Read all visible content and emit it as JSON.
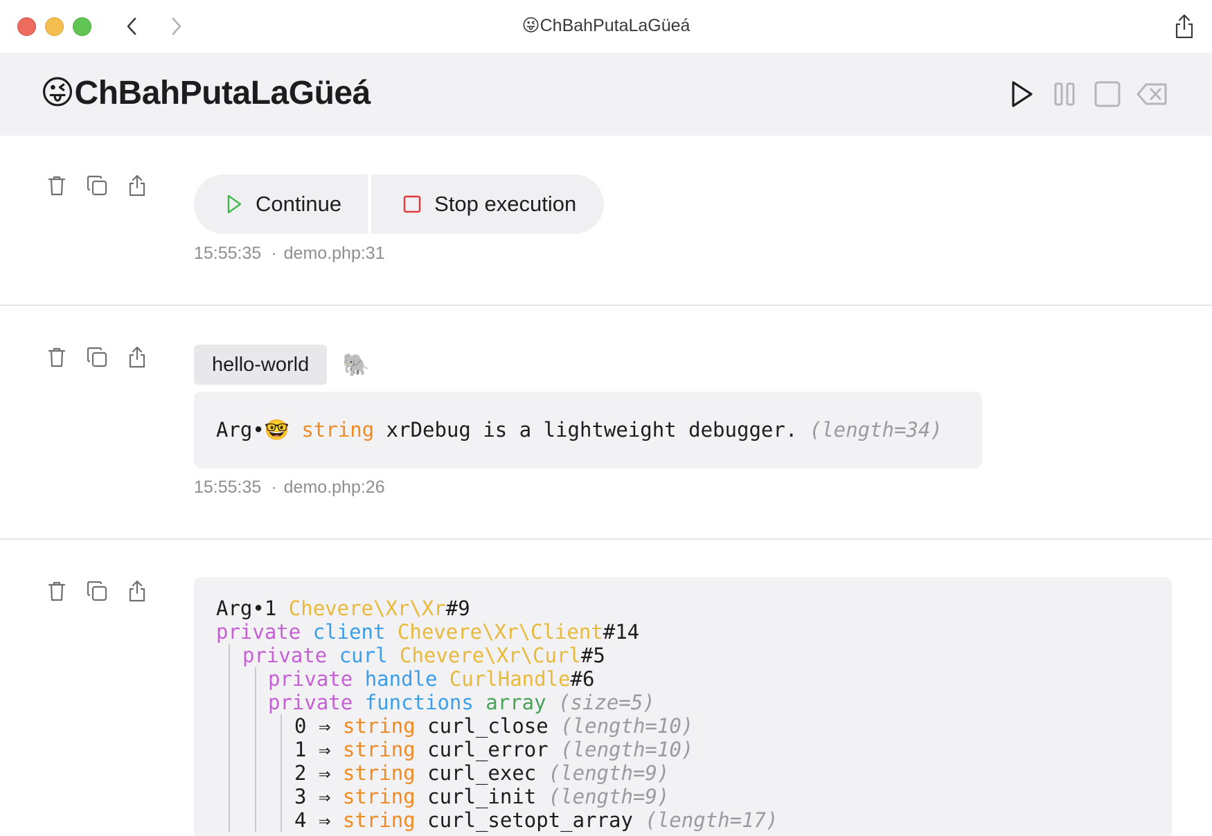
{
  "window": {
    "title": "😜ChBahPutaLaGüeá",
    "traffic_colors": {
      "close": "#ed6a5e",
      "minimize": "#f4bf4f",
      "zoom": "#61c554"
    },
    "icons": [
      "chevron-left-icon",
      "chevron-right-icon",
      "share-icon"
    ]
  },
  "header": {
    "title": "😜ChBahPutaLaGüeá",
    "controls": [
      "play-icon",
      "pause-icon",
      "stop-icon",
      "clear-icon"
    ]
  },
  "entries": [
    {
      "actions": [
        "trash-icon",
        "copy-icon",
        "share-icon"
      ],
      "buttons": {
        "continue": "Continue",
        "stop": "Stop execution"
      },
      "time": "15:55:35",
      "sep": "·",
      "file": "demo.php:31"
    },
    {
      "actions": [
        "trash-icon",
        "copy-icon",
        "share-icon"
      ],
      "tag": "hello-world",
      "emoji": "🐘",
      "code": {
        "arg": "Arg•",
        "arg_emoji": "🤓",
        "type": "string",
        "value": "xrDebug is a lightweight debugger.",
        "meta": "(length=34)"
      },
      "time": "15:55:35",
      "sep": "·",
      "file": "demo.php:26"
    },
    {
      "actions": [
        "trash-icon",
        "copy-icon",
        "share-icon"
      ],
      "dump": {
        "arg": "Arg•1",
        "root_class": "Chevere\\Xr\\Xr",
        "root_id": "#9",
        "private": "private",
        "client_prop": "client",
        "client_class": "Chevere\\Xr\\Client",
        "client_id": "#14",
        "curl_prop": "curl",
        "curl_class": "Chevere\\Xr\\Curl",
        "curl_id": "#5",
        "handle_prop": "handle",
        "handle_class": "CurlHandle",
        "handle_id": "#6",
        "functions_prop": "functions",
        "functions_type": "array",
        "functions_meta": "(size=5)",
        "arrow": "⇒",
        "string_type": "string",
        "items": [
          {
            "key": "0",
            "value": "curl_close",
            "meta": "(length=10)"
          },
          {
            "key": "1",
            "value": "curl_error",
            "meta": "(length=10)"
          },
          {
            "key": "2",
            "value": "curl_exec",
            "meta": "(length=9)"
          },
          {
            "key": "3",
            "value": "curl_init",
            "meta": "(length=9)"
          },
          {
            "key": "4",
            "value": "curl_setopt_array",
            "meta": "(length=17)"
          }
        ]
      }
    }
  ]
}
